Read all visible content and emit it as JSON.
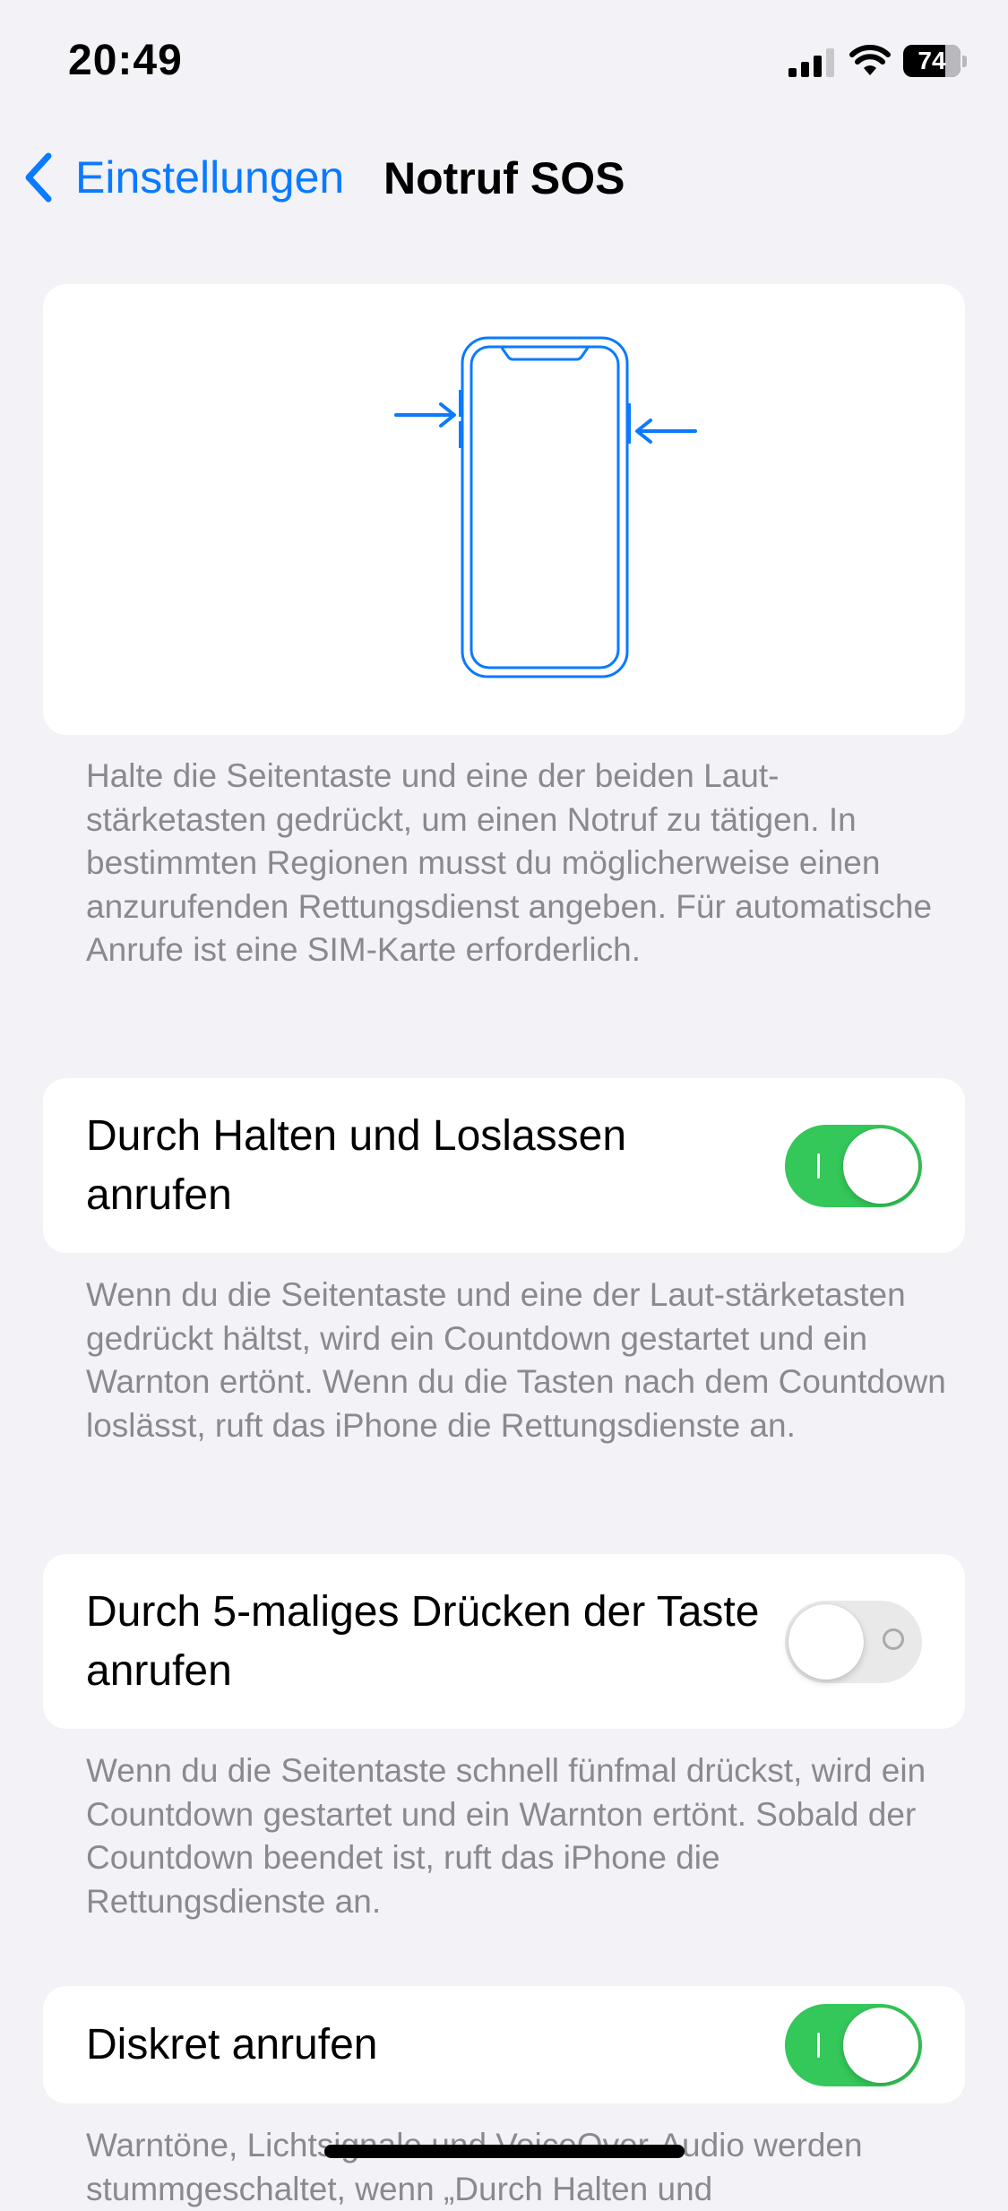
{
  "status_bar": {
    "time": "20:49",
    "battery_level": "74",
    "battery_percent": 74,
    "signal_icon": "cellular-signal-icon",
    "wifi_icon": "wifi-icon"
  },
  "nav": {
    "back_icon": "chevron-left-icon",
    "back_label": "Einstellungen",
    "title": "Notruf SOS"
  },
  "illustration": {
    "icon": "phone-side-buttons-illustration"
  },
  "intro_footnote": "Halte die Seitentaste und eine der beiden Laut-stärketasten gedrückt, um einen Notruf zu tätigen. In bestimmten Regionen musst du möglicherweise einen anzurufenden Rettungsdienst angeben. Für automatische Anrufe ist eine SIM-Karte erforderlich.",
  "settings": [
    {
      "label": "Durch Halten und Loslassen anrufen",
      "enabled": true,
      "footnote": "Wenn du die Seitentaste und eine der Laut-stärketasten gedrückt hältst, wird ein Countdown gestartet und ein Warnton ertönt. Wenn du die Tasten nach dem Countdown loslässt, ruft das iPhone die Rettungsdienste an."
    },
    {
      "label": "Durch 5-maliges Drücken der Taste anrufen",
      "enabled": false,
      "footnote": "Wenn du die Seitentaste schnell fünfmal drückst, wird ein Countdown gestartet und ein Warnton ertönt. Sobald der Countdown beendet ist, ruft das iPhone die Rettungsdienste an."
    },
    {
      "label": "Diskret anrufen",
      "enabled": true,
      "footnote": "Warntöne, Lichtsignale und VoiceOver-Audio werden stummgeschaltet, wenn „Durch Halten und"
    }
  ],
  "colors": {
    "accent": "#0a7aff",
    "toggle_on": "#34c759",
    "toggle_off": "#e9e9ea",
    "background": "#f2f2f7",
    "footnote": "#8a8a8e"
  }
}
